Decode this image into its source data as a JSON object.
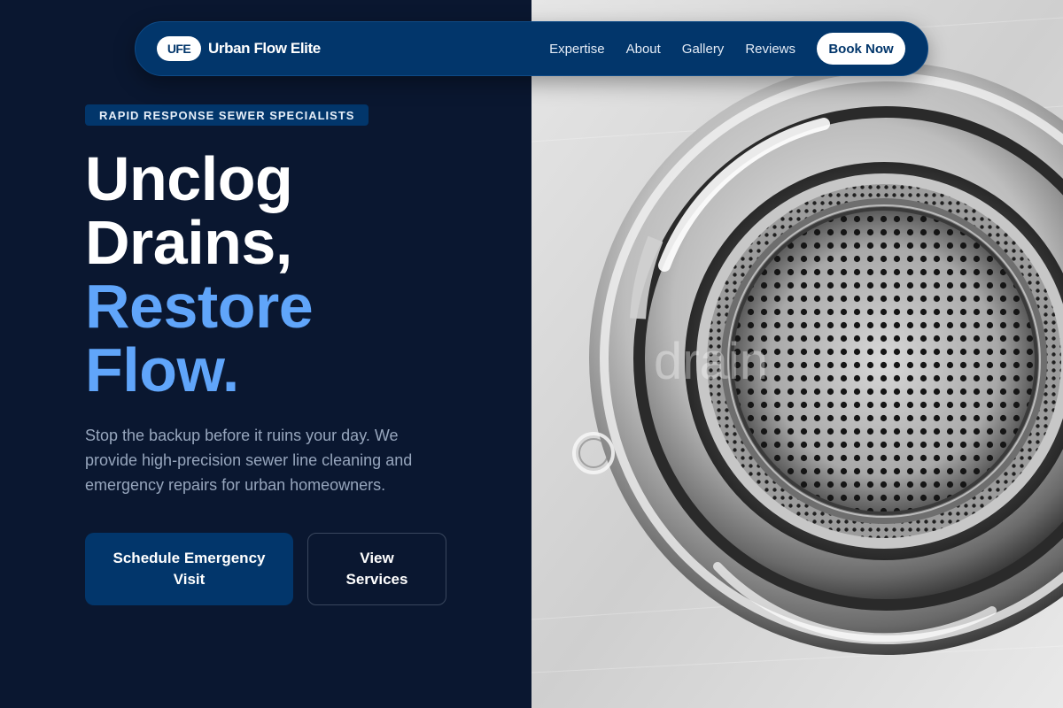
{
  "nav": {
    "logo_badge": "UFE",
    "brand_name": "Urban Flow Elite",
    "links": [
      "Expertise",
      "About",
      "Gallery",
      "Reviews"
    ],
    "cta": "Book Now"
  },
  "hero": {
    "eyebrow": "RAPID RESPONSE SEWER SPECIALISTS",
    "headline_line1": "Unclog",
    "headline_line2": "Drains,",
    "headline_line3": "Restore",
    "headline_line4": "Flow.",
    "description": "Stop the backup before it ruins your day. We provide high-precision sewer line cleaning and emergency repairs for urban homeowners.",
    "primary_button": "Schedule Emergency Visit",
    "secondary_button": "View Services"
  },
  "image": {
    "subject": "stainless-steel-sink-drain-strainer",
    "watermark": "drain"
  },
  "colors": {
    "background": "#0a1730",
    "brand_navy": "#02366b",
    "accent_blue": "#60a5fa",
    "muted_text": "#97a6bd"
  }
}
